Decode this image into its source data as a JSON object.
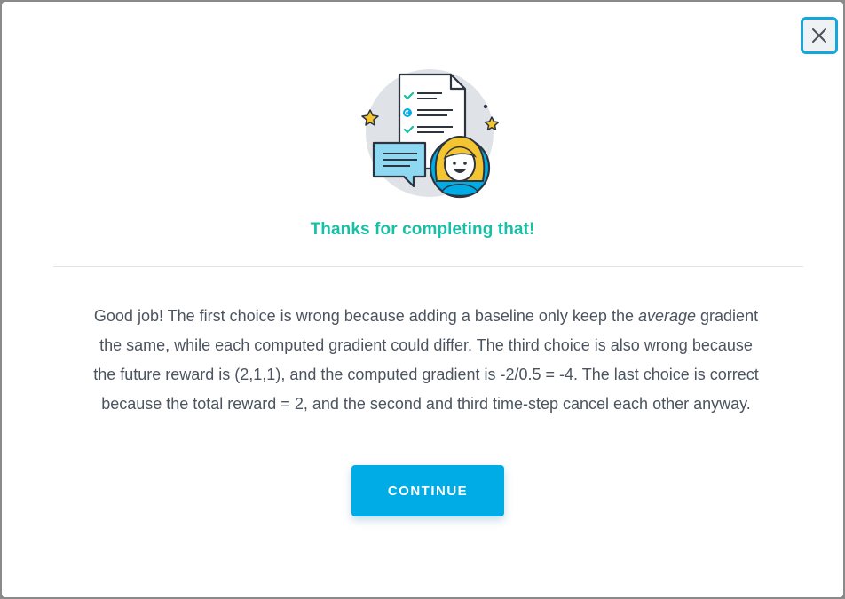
{
  "dialog": {
    "title": "Thanks for completing that!",
    "message": {
      "part1": "Good job! The first choice is wrong because adding a baseline only keep the ",
      "emphasis": "average",
      "part2": " gradient the same, while each computed gradient could differ. The third choice is also wrong because the future reward is (2,1,1), and the computed gradient is -2/0.5 = -4. The last choice is correct because the total reward = 2, and the second and third time-step cancel each other anyway."
    },
    "continue_label": "CONTINUE",
    "close_icon": "close-icon",
    "illustration_icon": "completed-checklist-illustration"
  },
  "colors": {
    "accent": "#00ace5",
    "title": "#17bfa5",
    "focus_ring": "#14a7de",
    "text": "#4c5460"
  }
}
